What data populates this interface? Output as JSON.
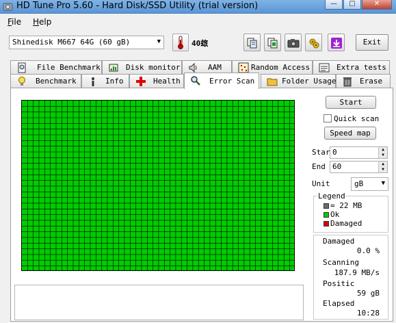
{
  "window": {
    "title": "HD Tune Pro 5.60 - Hard Disk/SSD Utility (trial version)",
    "minimize_label": "—",
    "maximize_label": "□",
    "close_label": "✕"
  },
  "menu": {
    "file": "ile",
    "file_key": "F",
    "help": "elp",
    "help_key": "H"
  },
  "toolbar": {
    "drive": "Shinedisk M667 64G (60 gB)",
    "temperature": "40玈",
    "exit_label": "Exit",
    "icons": [
      "copy-info-icon",
      "copy-screenshot-icon",
      "camera-icon",
      "options-icon",
      "save-icon"
    ]
  },
  "tabs_top": [
    {
      "label": "File Benchmark",
      "icon": "file-benchmark-icon"
    },
    {
      "label": "Disk monitor",
      "icon": "disk-monitor-icon"
    },
    {
      "label": "AAM",
      "icon": "speaker-icon"
    },
    {
      "label": "Random Access",
      "icon": "random-access-icon"
    },
    {
      "label": "Extra tests",
      "icon": "extra-tests-icon"
    }
  ],
  "tabs_bottom": [
    {
      "label": "Benchmark",
      "icon": "lightbulb-icon"
    },
    {
      "label": "Info",
      "icon": "info-icon"
    },
    {
      "label": "Health",
      "icon": "health-cross-icon"
    },
    {
      "label": "Error Scan",
      "icon": "magnifier-icon",
      "active": true
    },
    {
      "label": "Folder Usage",
      "icon": "folder-icon"
    },
    {
      "label": "Erase",
      "icon": "trash-icon"
    }
  ],
  "scan": {
    "start_label": "Start",
    "quick_scan_label": "Quick scan",
    "quick_scan_checked": false,
    "speed_map_label": "Speed map",
    "start_field_label": "Star",
    "start_value": "0",
    "end_field_label": "End",
    "end_value": "60",
    "unit_label": "Unit",
    "unit_value": "gB",
    "legend_title": "Legend",
    "legend": [
      {
        "label": "= 22 MB",
        "color": "#6b6b6b"
      },
      {
        "label": "Ok",
        "color": "#00cc00"
      },
      {
        "label": "Damaged",
        "color": "#dd0000"
      }
    ],
    "grid_color": "#00cc00"
  },
  "stats": {
    "damaged_label": "Damaged",
    "damaged_value": "0.0 %",
    "scanning_label": "Scanning",
    "scanning_value": "187.9 MB/s",
    "position_label": "Positic",
    "position_value": "59 gB",
    "elapsed_label": "Elapsed",
    "elapsed_value": "10:28"
  }
}
